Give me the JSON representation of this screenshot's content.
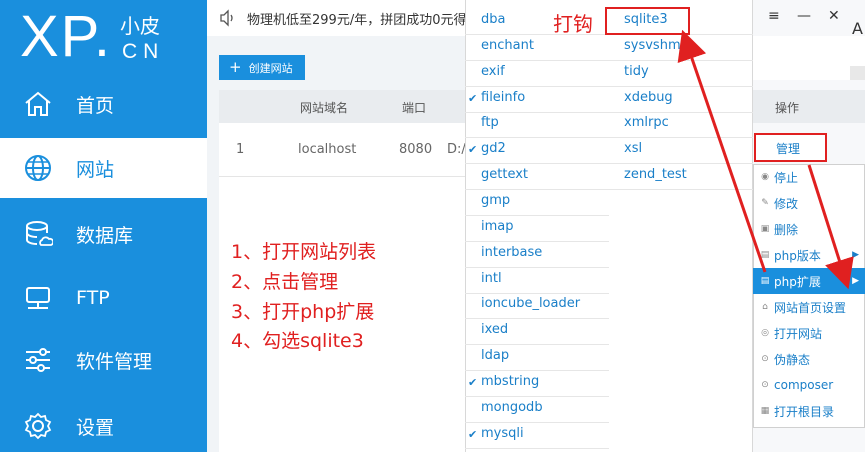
{
  "app": {
    "logo_main": "XP.",
    "logo_cn": "小皮",
    "logo_sub": "CN"
  },
  "sidebar": {
    "items": [
      {
        "label": "首页",
        "icon": "home-icon"
      },
      {
        "label": "网站",
        "icon": "globe-icon"
      },
      {
        "label": "数据库",
        "icon": "database-icon"
      },
      {
        "label": "FTP",
        "icon": "server-icon"
      },
      {
        "label": "软件管理",
        "icon": "sliders-icon"
      },
      {
        "label": "设置",
        "icon": "gear-icon"
      }
    ]
  },
  "notice": {
    "text": "物理机低至299元/年，拼团成功0元得"
  },
  "toolbar": {
    "create_label": "创建网站"
  },
  "table": {
    "headers": [
      "网站域名",
      "端口",
      "操作"
    ],
    "rows": [
      {
        "index": "1",
        "domain": "localhost",
        "port": "8080",
        "path": "D:/"
      }
    ],
    "manage_label": "管理"
  },
  "instructions": [
    "1、打开网站列表",
    "2、点击管理",
    "3、打开php扩展",
    "4、勾选sqlite3"
  ],
  "annotation": {
    "check_hint": "打钩"
  },
  "extensions": {
    "col1": [
      {
        "name": "dba",
        "checked": false
      },
      {
        "name": "enchant",
        "checked": false
      },
      {
        "name": "exif",
        "checked": false
      },
      {
        "name": "fileinfo",
        "checked": true
      },
      {
        "name": "ftp",
        "checked": false
      },
      {
        "name": "gd2",
        "checked": true
      },
      {
        "name": "gettext",
        "checked": false
      },
      {
        "name": "gmp",
        "checked": false
      },
      {
        "name": "imap",
        "checked": false
      },
      {
        "name": "interbase",
        "checked": false
      },
      {
        "name": "intl",
        "checked": false
      },
      {
        "name": "ioncube_loader",
        "checked": false
      },
      {
        "name": "ixed",
        "checked": false
      },
      {
        "name": "ldap",
        "checked": false
      },
      {
        "name": "mbstring",
        "checked": true
      },
      {
        "name": "mongodb",
        "checked": false
      },
      {
        "name": "mysqli",
        "checked": true
      }
    ],
    "col2": [
      {
        "name": "sqlite3",
        "checked": false
      },
      {
        "name": "sysvshm",
        "checked": false
      },
      {
        "name": "tidy",
        "checked": false
      },
      {
        "name": "xdebug",
        "checked": false
      },
      {
        "name": "xmlrpc",
        "checked": false
      },
      {
        "name": "xsl",
        "checked": false
      },
      {
        "name": "zend_test",
        "checked": false
      }
    ]
  },
  "context_menu": {
    "items": [
      {
        "label": "停止",
        "icon": "stop-icon",
        "submenu": false
      },
      {
        "label": "修改",
        "icon": "edit-icon",
        "submenu": false
      },
      {
        "label": "删除",
        "icon": "trash-icon",
        "submenu": false
      },
      {
        "label": "php版本",
        "icon": "php-version-icon",
        "submenu": true
      },
      {
        "label": "php扩展",
        "icon": "php-extension-icon",
        "submenu": true,
        "highlighted": true
      },
      {
        "label": "网站首页设置",
        "icon": "home-settings-icon",
        "submenu": false
      },
      {
        "label": "打开网站",
        "icon": "open-site-icon",
        "submenu": false
      },
      {
        "label": "伪静态",
        "icon": "rewrite-icon",
        "submenu": false
      },
      {
        "label": "composer",
        "icon": "composer-icon",
        "submenu": false
      },
      {
        "label": "打开根目录",
        "icon": "folder-icon",
        "submenu": false
      }
    ]
  },
  "window": {
    "menu_icon": "≡",
    "minimize_icon": "—",
    "close_icon": "✕",
    "truncated_letter": "A"
  },
  "colors": {
    "sidebar_bg": "#1a8fdd",
    "link": "#1a7fc8",
    "annotation_red": "#e02020",
    "highlight": "#1a8fdd"
  }
}
